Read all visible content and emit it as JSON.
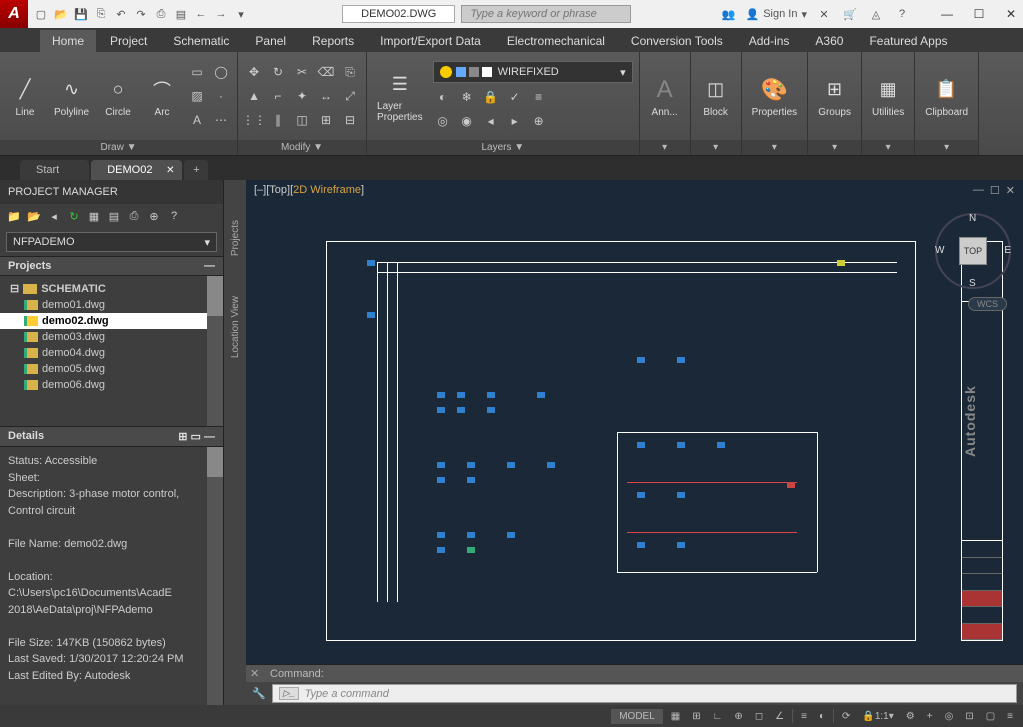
{
  "app": {
    "logo_letter": "A",
    "doc_title": "DEMO02.DWG",
    "search_placeholder": "Type a keyword or phrase",
    "sign_in": "Sign In"
  },
  "ribbon_tabs": [
    "Home",
    "Project",
    "Schematic",
    "Panel",
    "Reports",
    "Import/Export Data",
    "Electromechanical",
    "Conversion Tools",
    "Add-ins",
    "A360",
    "Featured Apps"
  ],
  "ribbon": {
    "draw": {
      "label": "Draw ▼",
      "items": [
        "Line",
        "Polyline",
        "Circle",
        "Arc"
      ]
    },
    "modify": {
      "label": "Modify ▼"
    },
    "layers": {
      "label": "Layers ▼",
      "prop_label": "Layer\nProperties",
      "current": "WIREFIXED"
    },
    "ann": "Ann...",
    "block": "Block",
    "properties": "Properties",
    "groups": "Groups",
    "utilities": "Utilities",
    "clipboard": "Clipboard"
  },
  "doc_tabs": {
    "tabs": [
      "Start",
      "DEMO02"
    ],
    "active": 1
  },
  "project_manager": {
    "title": "PROJECT MANAGER",
    "combo": "NFPADEMO",
    "projects_head": "Projects",
    "root": "SCHEMATIC",
    "files": [
      "demo01.dwg",
      "demo02.dwg",
      "demo03.dwg",
      "demo04.dwg",
      "demo05.dwg",
      "demo06.dwg"
    ],
    "selected": 1,
    "details_head": "Details",
    "status_label": "Status:",
    "status_value": "Accessible",
    "sheet_label": "Sheet:",
    "desc_label": "Description:",
    "desc_value": "3-phase motor control, Control circuit",
    "file_label": "File Name:",
    "file_value": "demo02.dwg",
    "loc_label": "Location:",
    "loc_value": "C:\\Users\\pc16\\Documents\\AcadE 2018\\AeData\\proj\\NFPAdemo",
    "size_label": "File Size:",
    "size_value": "147KB (150862 bytes)",
    "saved_label": "Last Saved:",
    "saved_value": "1/30/2017 12:20:24 PM",
    "edited_label": "Last Edited By:",
    "edited_value": "Autodesk"
  },
  "vtabs": [
    "Projects",
    "Location View"
  ],
  "canvas": {
    "view_prefix": "[–][Top][",
    "view_mode": "2D Wireframe",
    "view_suffix": "]",
    "cube": "TOP",
    "wcs": "WCS",
    "autodesk": "Autodesk"
  },
  "command": {
    "history": "Command:",
    "placeholder": "Type a command"
  },
  "statusbar": {
    "model": "MODEL",
    "scale": "1:1"
  }
}
